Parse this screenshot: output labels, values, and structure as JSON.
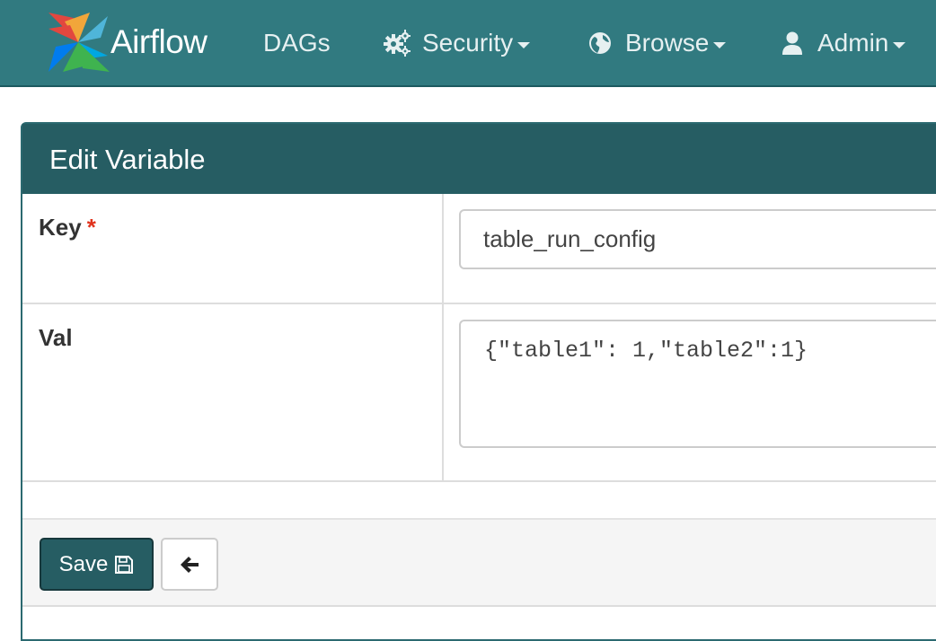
{
  "navbar": {
    "brand": "Airflow",
    "items": [
      {
        "label": "DAGs",
        "icon": ""
      },
      {
        "label": "Security",
        "icon": "gears-icon"
      },
      {
        "label": "Browse",
        "icon": "globe-icon"
      },
      {
        "label": "Admin",
        "icon": "user-icon"
      }
    ]
  },
  "panel": {
    "title": "Edit Variable",
    "fields": {
      "key": {
        "label": "Key",
        "required_mark": "*",
        "value": "table_run_config"
      },
      "val": {
        "label": "Val",
        "value": "{\"table1\": 1,\"table2\":1}"
      }
    },
    "actions": {
      "save_label": "Save",
      "save_icon": "floppy-disk-icon",
      "back_icon": "arrow-left-icon"
    }
  },
  "colors": {
    "navbar_bg": "#317a80",
    "panel_heading_bg": "#265d63",
    "required": "#e0331d"
  }
}
